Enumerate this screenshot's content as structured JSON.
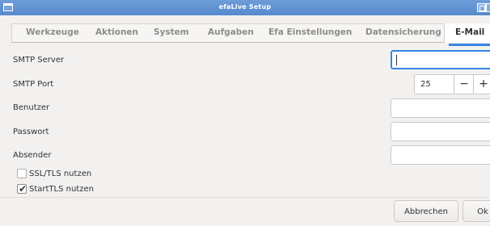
{
  "window": {
    "title": "efaLive Setup"
  },
  "tabs": [
    {
      "label": "Werkzeuge",
      "active": false
    },
    {
      "label": "Aktionen",
      "active": false
    },
    {
      "label": "System",
      "active": false
    },
    {
      "label": "Aufgaben",
      "active": false
    },
    {
      "label": "Efa Einstellungen",
      "active": false
    },
    {
      "label": "Datensicherung",
      "active": false
    },
    {
      "label": "E-Mail",
      "active": true
    }
  ],
  "form": {
    "smtp_server": {
      "label": "SMTP Server",
      "value": ""
    },
    "smtp_port": {
      "label": "SMTP Port",
      "value": "25",
      "decrement": "−",
      "increment": "+"
    },
    "benutzer": {
      "label": "Benutzer",
      "value": ""
    },
    "passwort": {
      "label": "Passwort",
      "value": ""
    },
    "absender": {
      "label": "Absender",
      "value": ""
    },
    "ssl_tls": {
      "label": "SSL/TLS nutzen",
      "checked": false
    },
    "starttls": {
      "label": "StartTLS nutzen",
      "checked": true,
      "mark": "✔"
    }
  },
  "buttons": {
    "cancel": "Abbrechen",
    "ok": "Ok"
  },
  "colors": {
    "titlebar": "#5589cc",
    "accent": "#3584e4",
    "background": "#f2f1f0"
  }
}
